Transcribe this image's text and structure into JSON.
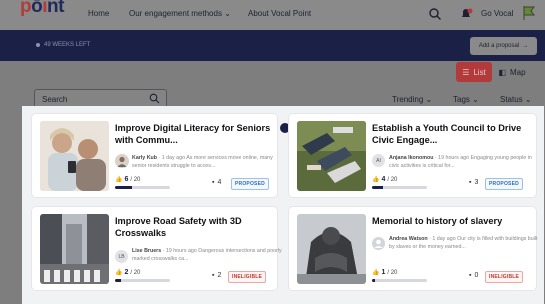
{
  "nav": {
    "logo_main": "point",
    "links": [
      "Home",
      "Our engagement methods",
      "About Vocal Point"
    ],
    "user": "Go Vocal"
  },
  "banner": {
    "weeks_left": "49 WEEKS LEFT",
    "add_proposal": "Add a proposal"
  },
  "view_toggle": {
    "list": "List",
    "map": "Map"
  },
  "filters": {
    "search_placeholder": "Search",
    "sort": "Trending",
    "tags": "Tags",
    "status": "Status"
  },
  "cards": [
    {
      "title": "Improve Digital Literacy for Seniors with Commu...",
      "author": "Karly Kub",
      "time": "1 day ago",
      "excerpt": "As more services move online, many senior residents struggle to acces...",
      "votes": "6",
      "votes_total": "/ 20",
      "vote_fraction": 0.3,
      "comments": "4",
      "status": "PROPOSED"
    },
    {
      "title": "Establish a Youth Council to Drive Civic Engage...",
      "author": "Anjana Ikonomou",
      "avatar_initials": "AI",
      "time": "19 hours ago",
      "excerpt": "Engaging young people in civic activities is critical for...",
      "votes": "4",
      "votes_total": "/ 20",
      "vote_fraction": 0.2,
      "comments": "3",
      "status": "PROPOSED"
    },
    {
      "title": "Improve Road Safety with 3D Crosswalks",
      "author": "Lise Bruers",
      "avatar_initials": "LB",
      "time": "19 hours ago",
      "excerpt": "Dangerous intersections and poorly marked crosswalks ca...",
      "votes": "2",
      "votes_total": "/ 20",
      "vote_fraction": 0.1,
      "comments": "2",
      "status": "INELIGIBLE"
    },
    {
      "title": "Memorial to history of slavery",
      "author": "Andrea Watson",
      "time": "1 day ago",
      "excerpt": "Our city is filled with buildings built by slaves or the money earned...",
      "votes": "1",
      "votes_total": "/ 20",
      "vote_fraction": 0.05,
      "comments": "0",
      "status": "INELIGIBLE"
    }
  ],
  "colors": {
    "brand_navy": "#1b2046",
    "accent_red": "#b23a3a",
    "proposed_blue": "#2a6fc2",
    "ineligible_red": "#c0392b"
  }
}
